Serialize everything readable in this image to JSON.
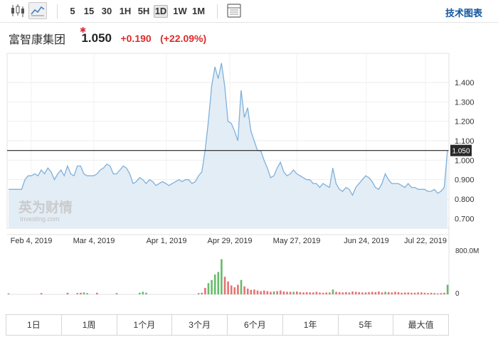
{
  "toolbar": {
    "icons": {
      "candlestick": "candlestick-icon",
      "area": "area-chart-icon",
      "table": "table-icon"
    },
    "intervals": [
      "5",
      "15",
      "30",
      "1H",
      "5H",
      "1D",
      "1W",
      "1M"
    ],
    "active_interval": "1D",
    "technical_chart_label": "技术图表"
  },
  "quote": {
    "name": "富智康集团",
    "price": "1.050",
    "change": "+0.190",
    "change_pct": "(+22.09%)"
  },
  "watermark": {
    "cn": "英为财情",
    "en": "Investing.com"
  },
  "colors": {
    "area_line": "#7fb0da",
    "area_fill": "#e3edf6",
    "last_price_line": "#222222",
    "up": "#e57373",
    "down": "#66bb6a",
    "change": "#dd2c2c",
    "link": "#1256a0"
  },
  "chart_data": {
    "type": "area",
    "title": "",
    "xlabel": "",
    "ylabel": "",
    "ylim": [
      0.65,
      1.55
    ],
    "y_ticks": [
      "1.400",
      "1.300",
      "1.200",
      "1.100",
      "1.000",
      "0.900",
      "0.800",
      "0.700"
    ],
    "x_ticks": [
      "Feb 4, 2019",
      "Mar 4, 2019",
      "Apr 1, 2019",
      "Apr 29, 2019",
      "May 27, 2019",
      "Jun 24, 2019",
      "Jul 22, 2019"
    ],
    "last_price_label": "1.050",
    "last_price": 1.05,
    "grid": true,
    "close": [
      0.85,
      0.85,
      0.85,
      0.85,
      0.85,
      0.9,
      0.92,
      0.92,
      0.93,
      0.92,
      0.95,
      0.93,
      0.96,
      0.94,
      0.9,
      0.93,
      0.95,
      0.92,
      0.97,
      0.93,
      0.92,
      0.97,
      0.97,
      0.93,
      0.92,
      0.92,
      0.92,
      0.93,
      0.95,
      0.96,
      0.98,
      0.97,
      0.93,
      0.93,
      0.95,
      0.97,
      0.96,
      0.93,
      0.88,
      0.89,
      0.91,
      0.9,
      0.88,
      0.9,
      0.89,
      0.87,
      0.88,
      0.89,
      0.88,
      0.87,
      0.88,
      0.89,
      0.9,
      0.89,
      0.9,
      0.9,
      0.88,
      0.89,
      0.92,
      0.94,
      1.05,
      1.2,
      1.38,
      1.48,
      1.42,
      1.5,
      1.38,
      1.2,
      1.19,
      1.15,
      1.1,
      1.36,
      1.22,
      1.27,
      1.15,
      1.1,
      1.05,
      1.05,
      1.0,
      0.96,
      0.91,
      0.92,
      0.96,
      0.99,
      0.94,
      0.92,
      0.93,
      0.95,
      0.93,
      0.92,
      0.91,
      0.9,
      0.9,
      0.88,
      0.88,
      0.86,
      0.88,
      0.87,
      0.86,
      0.96,
      0.88,
      0.85,
      0.84,
      0.86,
      0.85,
      0.82,
      0.86,
      0.88,
      0.9,
      0.92,
      0.91,
      0.89,
      0.86,
      0.85,
      0.88,
      0.93,
      0.9,
      0.88,
      0.88,
      0.88,
      0.87,
      0.86,
      0.88,
      0.86,
      0.86,
      0.85,
      0.85,
      0.85,
      0.84,
      0.84,
      0.85,
      0.83,
      0.84,
      0.86,
      1.05
    ],
    "volume_axis": [
      "800.0M",
      "0"
    ],
    "volume": [
      3,
      0,
      0,
      0,
      0,
      0,
      0,
      0,
      0,
      0,
      4,
      0,
      0,
      0,
      0,
      0,
      0,
      0,
      5,
      0,
      0,
      4,
      5,
      6,
      4,
      0,
      0,
      5,
      0,
      0,
      0,
      0,
      0,
      4,
      0,
      0,
      0,
      0,
      0,
      0,
      5,
      8,
      5,
      0,
      0,
      0,
      0,
      0,
      0,
      0,
      0,
      0,
      0,
      0,
      0,
      0,
      0,
      0,
      4,
      5,
      20,
      35,
      45,
      62,
      70,
      110,
      55,
      40,
      28,
      22,
      30,
      45,
      25,
      18,
      14,
      15,
      12,
      10,
      12,
      10,
      8,
      9,
      10,
      12,
      9,
      8,
      8,
      8,
      9,
      7,
      6,
      7,
      6,
      6,
      8,
      6,
      5,
      6,
      6,
      15,
      8,
      7,
      6,
      7,
      6,
      9,
      8,
      7,
      6,
      6,
      7,
      8,
      7,
      9,
      6,
      8,
      7,
      6,
      8,
      7,
      5,
      6,
      6,
      5,
      5,
      6,
      6,
      5,
      4,
      5,
      4,
      3,
      4,
      5,
      30
    ],
    "volume_dir": [
      "d",
      "u",
      "u",
      "u",
      "u",
      "u",
      "u",
      "u",
      "u",
      "u",
      "u",
      "u",
      "u",
      "u",
      "u",
      "u",
      "u",
      "u",
      "u",
      "u",
      "u",
      "u",
      "u",
      "d",
      "d",
      "u",
      "u",
      "u",
      "u",
      "u",
      "u",
      "u",
      "u",
      "d",
      "u",
      "u",
      "u",
      "u",
      "u",
      "u",
      "d",
      "d",
      "d",
      "u",
      "u",
      "u",
      "u",
      "u",
      "u",
      "u",
      "u",
      "u",
      "u",
      "u",
      "u",
      "u",
      "u",
      "u",
      "d",
      "u",
      "u",
      "d",
      "d",
      "d",
      "d",
      "d",
      "u",
      "u",
      "u",
      "u",
      "u",
      "d",
      "u",
      "u",
      "u",
      "u",
      "u",
      "u",
      "u",
      "u",
      "u",
      "d",
      "u",
      "u",
      "u",
      "u",
      "u",
      "d",
      "u",
      "u",
      "u",
      "u",
      "u",
      "u",
      "u",
      "u",
      "u",
      "u",
      "u",
      "d",
      "u",
      "u",
      "u",
      "u",
      "u",
      "u",
      "u",
      "u",
      "u",
      "u",
      "u",
      "u",
      "u",
      "u",
      "u",
      "d",
      "u",
      "u",
      "u",
      "u",
      "u",
      "u",
      "u",
      "u",
      "u",
      "u",
      "u",
      "u",
      "u",
      "u",
      "u",
      "u",
      "u",
      "u",
      "d"
    ]
  },
  "ranges": [
    "1日",
    "1周",
    "1个月",
    "3个月",
    "6个月",
    "1年",
    "5年",
    "最大值"
  ]
}
